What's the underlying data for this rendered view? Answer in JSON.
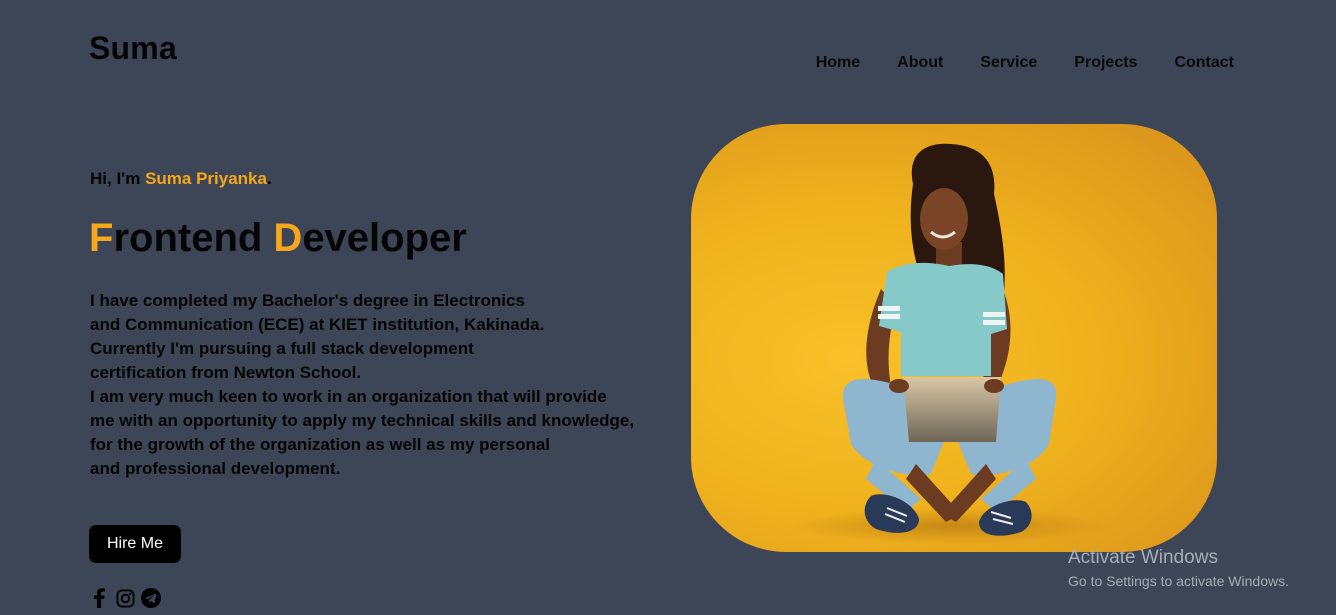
{
  "header": {
    "logo": "Suma",
    "nav": [
      "Home",
      "About",
      "Service",
      "Projects",
      "Contact"
    ]
  },
  "intro": {
    "greeting_prefix": "Hi, I'm ",
    "name": "Suma Priyanka",
    "greeting_suffix": ".",
    "title_initial_1": "F",
    "title_rest_1": "rontend ",
    "title_initial_2": "D",
    "title_rest_2": "eveloper",
    "bio_lines": [
      "I have completed my Bachelor's degree in Electronics",
      "and Communication (ECE) at KIET institution, Kakinada.",
      "Currently I'm pursuing a full stack development",
      "certification from Newton School.",
      "I am very much keen to work in an organization that will provide",
      "me with an opportunity to apply my technical skills and knowledge,",
      "for the growth of the organization as well as my personal",
      "and professional development."
    ],
    "cta_label": "Hire Me"
  },
  "social": {
    "icons": [
      "facebook-icon",
      "instagram-icon",
      "telegram-icon"
    ]
  },
  "hero": {
    "image": "woman-with-laptop-photo"
  },
  "watermark": {
    "title": "Activate Windows",
    "subtitle": "Go to Settings to activate Windows."
  },
  "colors": {
    "background": "#3c4656",
    "accent": "#f6a71b",
    "text": "#050505",
    "button": "#000000"
  }
}
